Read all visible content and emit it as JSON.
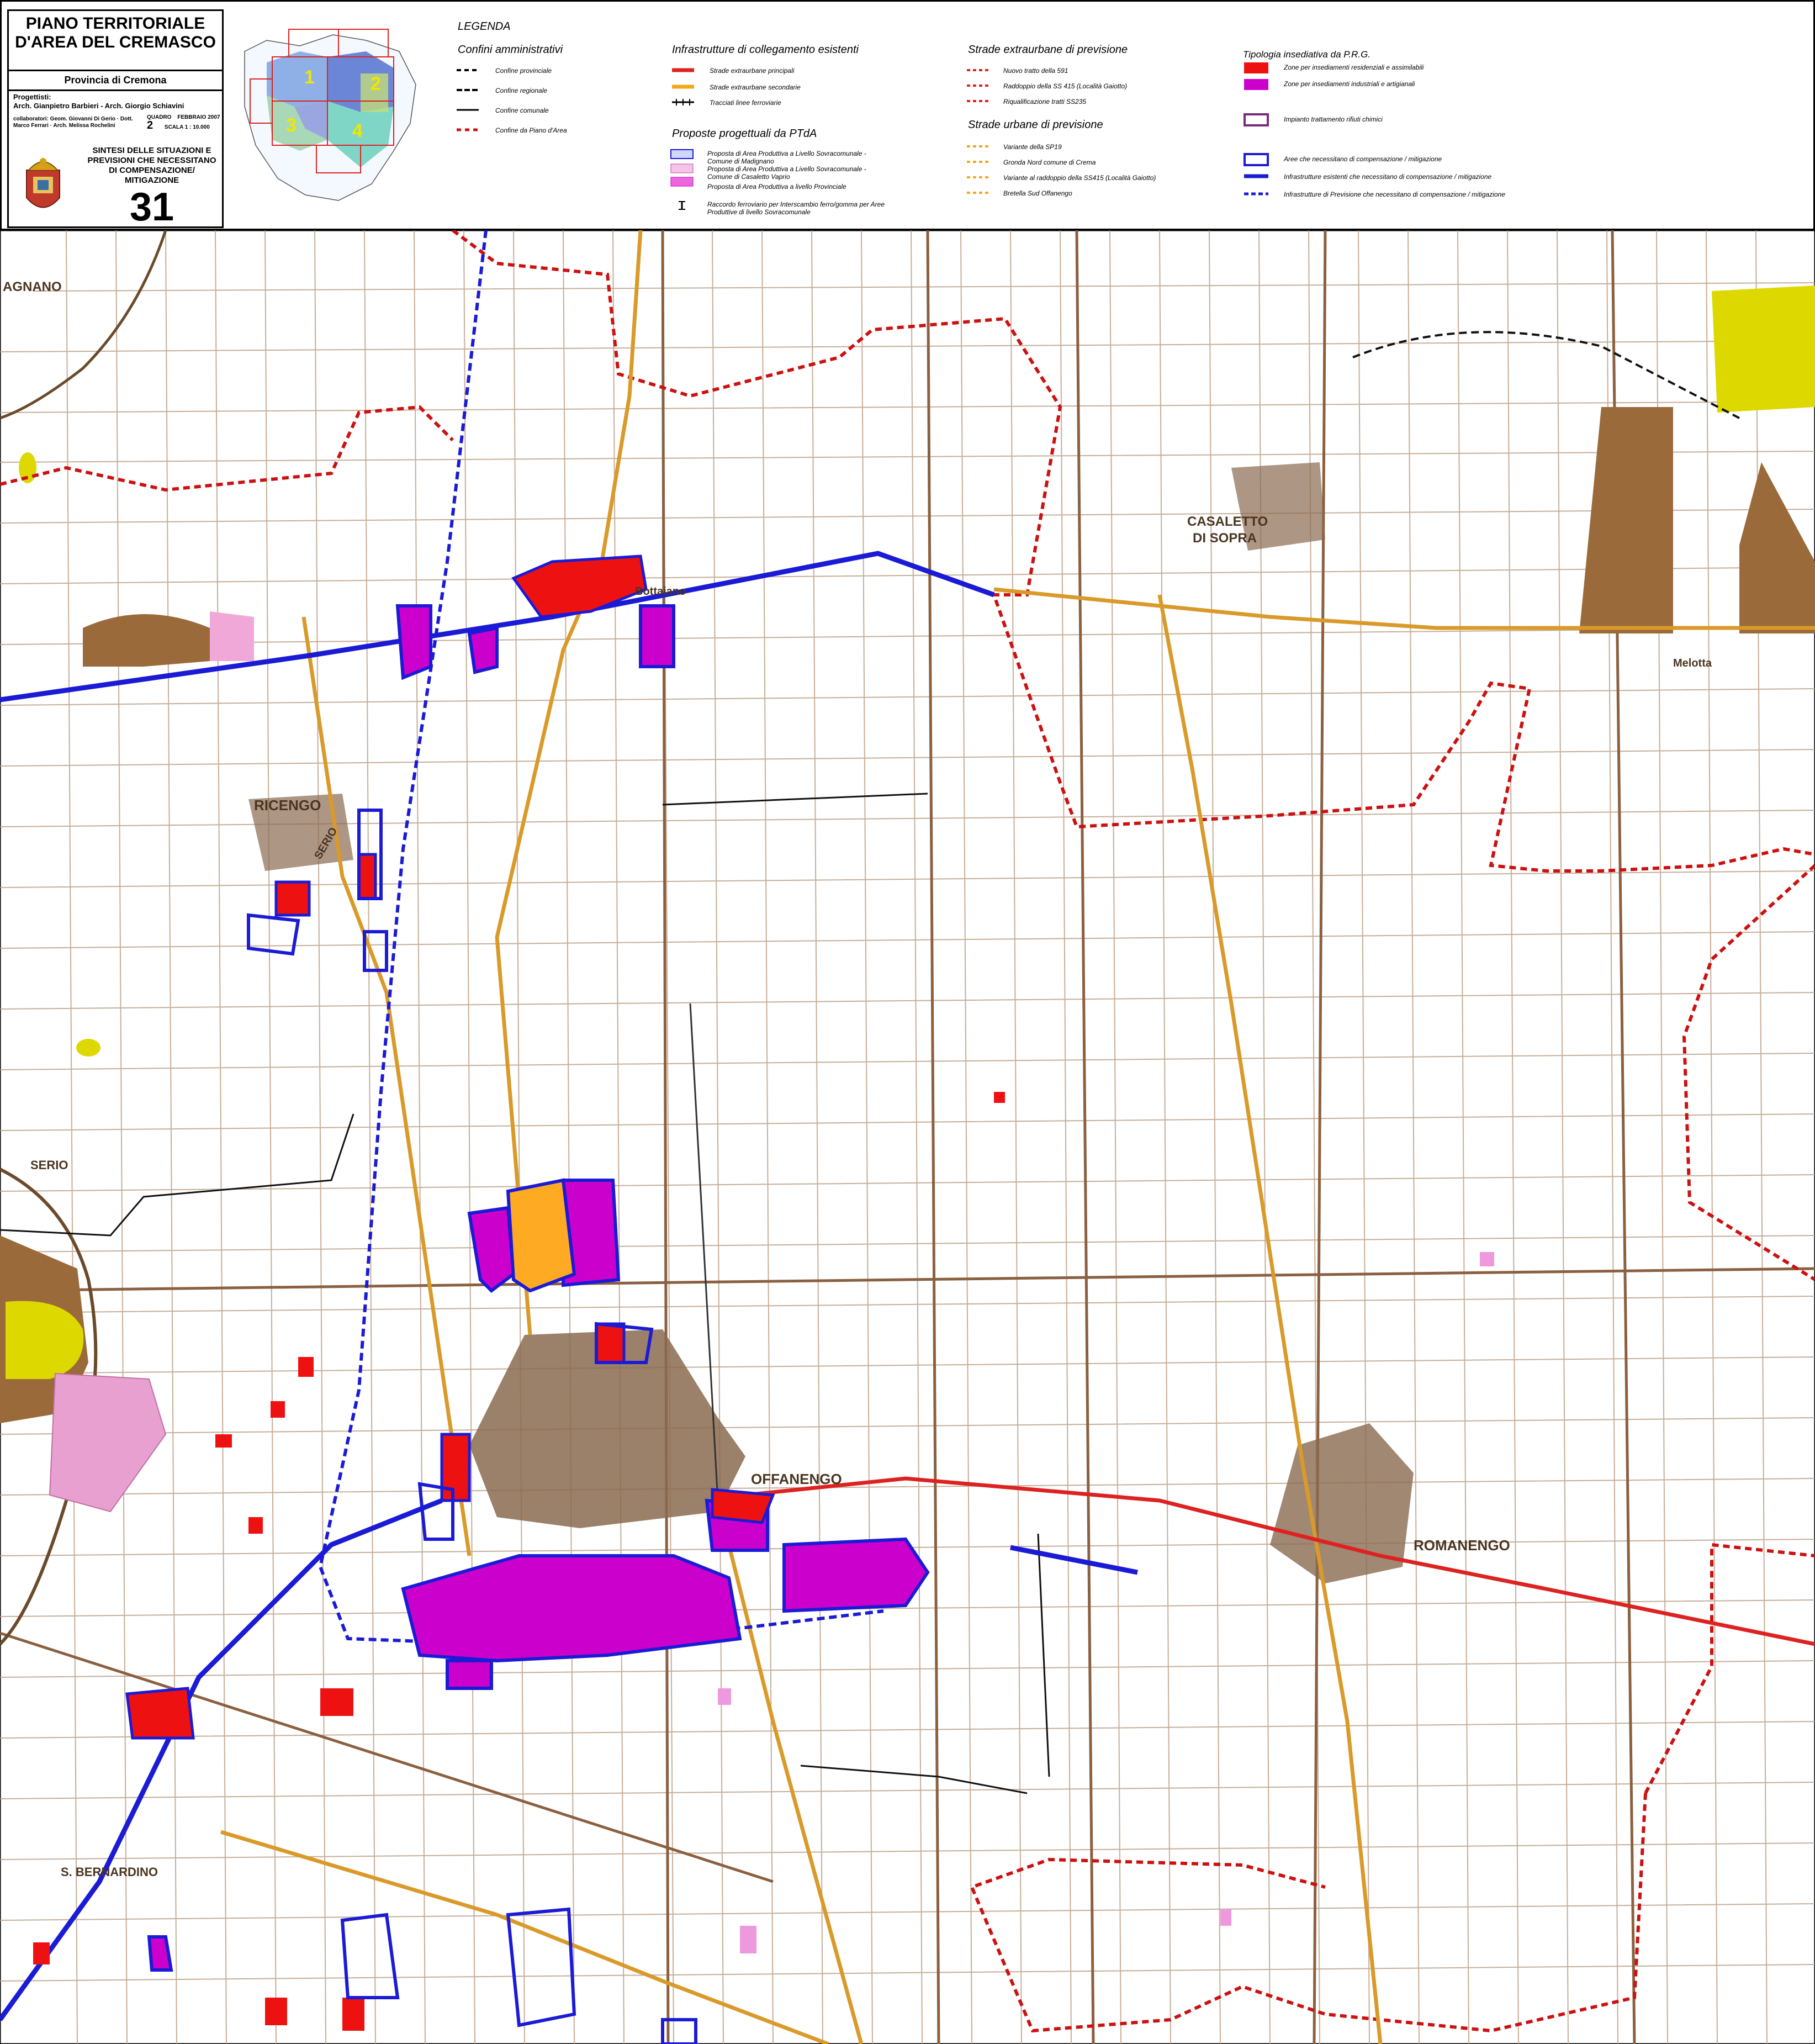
{
  "title": {
    "main_line1": "PIANO TERRITORIALE",
    "main_line2": "D'AREA DEL CREMASCO",
    "province": "Provincia di Cremona",
    "designers_label": "Progettisti:",
    "designers": "Arch. Gianpietro Barbieri - Arch. Giorgio Schiavini",
    "collaborators": "collaboratori: Geom. Giovanni Di Gerio · Dott. Marco Ferrari · Arch. Melissa Rochelini",
    "quadro_label": "QUADRO",
    "quadro_value": "2",
    "date": "FEBBRAIO 2007",
    "scale": "SCALA 1 : 10.000",
    "subtitle_l1": "SINTESI DELLE SITUAZIONI E",
    "subtitle_l2": "PREVISIONI CHE NECESSITANO",
    "subtitle_l3": "DI COMPENSAZIONE/",
    "subtitle_l4": "MITIGAZIONE",
    "sheet_number": "31"
  },
  "keymap": {
    "quadrants": [
      "1",
      "2",
      "3",
      "4"
    ]
  },
  "legend": {
    "heading": "LEGENDA",
    "confini": {
      "title": "Confini amministrativi",
      "items": [
        "Confine provinciale",
        "Confine regionale",
        "Confine comunale",
        "Confine da Piano d'Area"
      ]
    },
    "infrastrutture": {
      "title": "Infrastrutture di collegamento esistenti",
      "items": [
        "Strade extraurbane principali",
        "Strade extraurbane secondarie",
        "Tracciati linee ferroviarie"
      ]
    },
    "proposte": {
      "title": "Proposte progettuali da PTdA",
      "items": [
        "Proposta di Area Produttiva a Livello Sovracomunale - Comune di Madignano",
        "Proposta di Area Produttiva a Livello Sovracomunale - Comune di Casaletto Vaprio",
        "Proposta di Area Produttiva a livello Provinciale",
        "Raccordo ferroviario per Interscambio ferro/gomma per Aree Produttive di livello Sovracomunale"
      ]
    },
    "extraurbane_previsione": {
      "title": "Strade extraurbane di previsione",
      "items": [
        "Nuovo tratto della 591",
        "Raddoppio della SS 415 (Località Gaiotto)",
        "Riqualificazione tratti SS235"
      ]
    },
    "urbane_previsione": {
      "title": "Strade urbane di previsione",
      "items": [
        "Variante della SP19",
        "Gronda Nord comune di Crema",
        "Variante al raddoppio della SS415 (Località Gaiotto)",
        "Bretella Sud Offanengo"
      ]
    },
    "tipologia": {
      "title": "Tipologia insediativa da P.R.G.",
      "items": [
        "Zone per insediamenti residenziali e assimilabili",
        "Zone per insediamenti industriali e artigianali",
        "Impianto trattamento rifiuti chimici",
        "Aree che necessitano di compensazione / mitigazione",
        "Infrastrutture esistenti che necessitano di compensazione / mitigazione",
        "Infrastrutture di Previsione che necessitano di compensazione / mitigazione"
      ]
    }
  },
  "map_labels": {
    "ricengo": "RICENGO",
    "offanengo": "OFFANENGO",
    "romanengo": "ROMANENGO",
    "casaletto_l1": "CASALETTO",
    "casaletto_l2": "DI SOPRA",
    "bottaiano": "Bottaiano",
    "melotta": "Melotta",
    "s_bernardino": "S. BERNARDINO",
    "madignano": "AGNANO",
    "serio_1": "SERIO",
    "serio_2": "SERIO"
  },
  "colors": {
    "residential": "#ee1111",
    "industrial": "#cc00cc",
    "industrial_light": "#e040e0",
    "proposal_orange": "#ffaa22",
    "mitigation_blue": "#1b1bd6",
    "provincial_border": "#cc1111",
    "road_secondary": "#d99a2a",
    "road_principal": "#dd2222",
    "quarry_brown": "#9a6a3a",
    "yellow_area": "#ddd800",
    "pink_area": "#e7a0d0",
    "base_map_brown": "#7a5535"
  }
}
